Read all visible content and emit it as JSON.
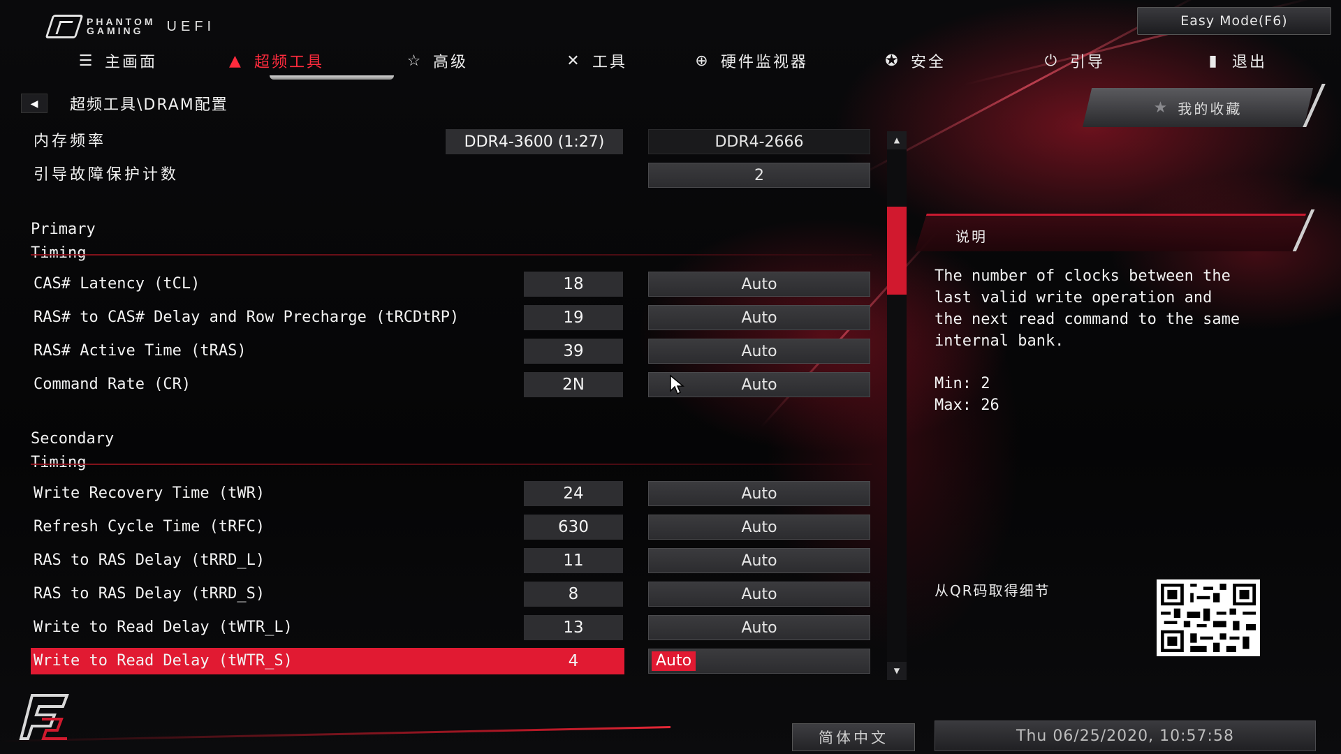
{
  "header": {
    "logo_line1": "PHANTOM",
    "logo_line2": "GAMING",
    "logo_uefi": "UEFI",
    "easy_mode_label": "Easy Mode(F6)"
  },
  "nav": {
    "tabs": [
      {
        "label": "主画面",
        "icon": "list-icon"
      },
      {
        "label": "超频工具",
        "icon": "flame-icon",
        "active": true
      },
      {
        "label": "高级",
        "icon": "star-icon"
      },
      {
        "label": "工具",
        "icon": "tools-icon"
      },
      {
        "label": "硬件监视器",
        "icon": "monitor-icon"
      },
      {
        "label": "安全",
        "icon": "shield-icon"
      },
      {
        "label": "引导",
        "icon": "power-icon"
      },
      {
        "label": "退出",
        "icon": "exit-icon"
      }
    ]
  },
  "breadcrumb": "超频工具\\DRAM配置",
  "settings": {
    "memory_freq": {
      "label": "内存频率",
      "current": "DDR4-3600 (1:27)",
      "option": "DDR4-2666"
    },
    "boot_failure": {
      "label": "引导故障保护计数",
      "option": "2"
    },
    "primary_title": "Primary Timing",
    "primary": [
      {
        "label": "CAS# Latency (tCL)",
        "value": "18",
        "option": "Auto"
      },
      {
        "label": "RAS# to CAS# Delay and Row Precharge (tRCDtRP)",
        "value": "19",
        "option": "Auto"
      },
      {
        "label": "RAS# Active Time (tRAS)",
        "value": "39",
        "option": "Auto"
      },
      {
        "label": "Command Rate (CR)",
        "value": "2N",
        "option": "Auto"
      }
    ],
    "secondary_title": "Secondary Timing",
    "secondary": [
      {
        "label": "Write Recovery Time (tWR)",
        "value": "24",
        "option": "Auto"
      },
      {
        "label": "Refresh Cycle Time (tRFC)",
        "value": "630",
        "option": "Auto"
      },
      {
        "label": "RAS to RAS Delay (tRRD_L)",
        "value": "11",
        "option": "Auto"
      },
      {
        "label": "RAS to RAS Delay (tRRD_S)",
        "value": "8",
        "option": "Auto"
      },
      {
        "label": "Write to Read Delay (tWTR_L)",
        "value": "13",
        "option": "Auto"
      },
      {
        "label": "Write to Read Delay (tWTR_S)",
        "value": "4",
        "option": "Auto",
        "selected": true
      }
    ]
  },
  "right_panel": {
    "favorites_label": "我的收藏",
    "description_title": "说明",
    "description_text": "The number of clocks between the\nlast valid write operation and\nthe next read command to the same\ninternal bank.",
    "min_label": "Min: 2",
    "max_label": "Max: 26",
    "qr_label": "从QR码取得细节"
  },
  "footer": {
    "language": "简体中文",
    "datetime": "Thu 06/25/2020, 10:57:58"
  },
  "colors": {
    "accent": "#e11a32",
    "active_tab": "#ff2b3d",
    "background": "#050506",
    "field": "#2e2e31"
  }
}
